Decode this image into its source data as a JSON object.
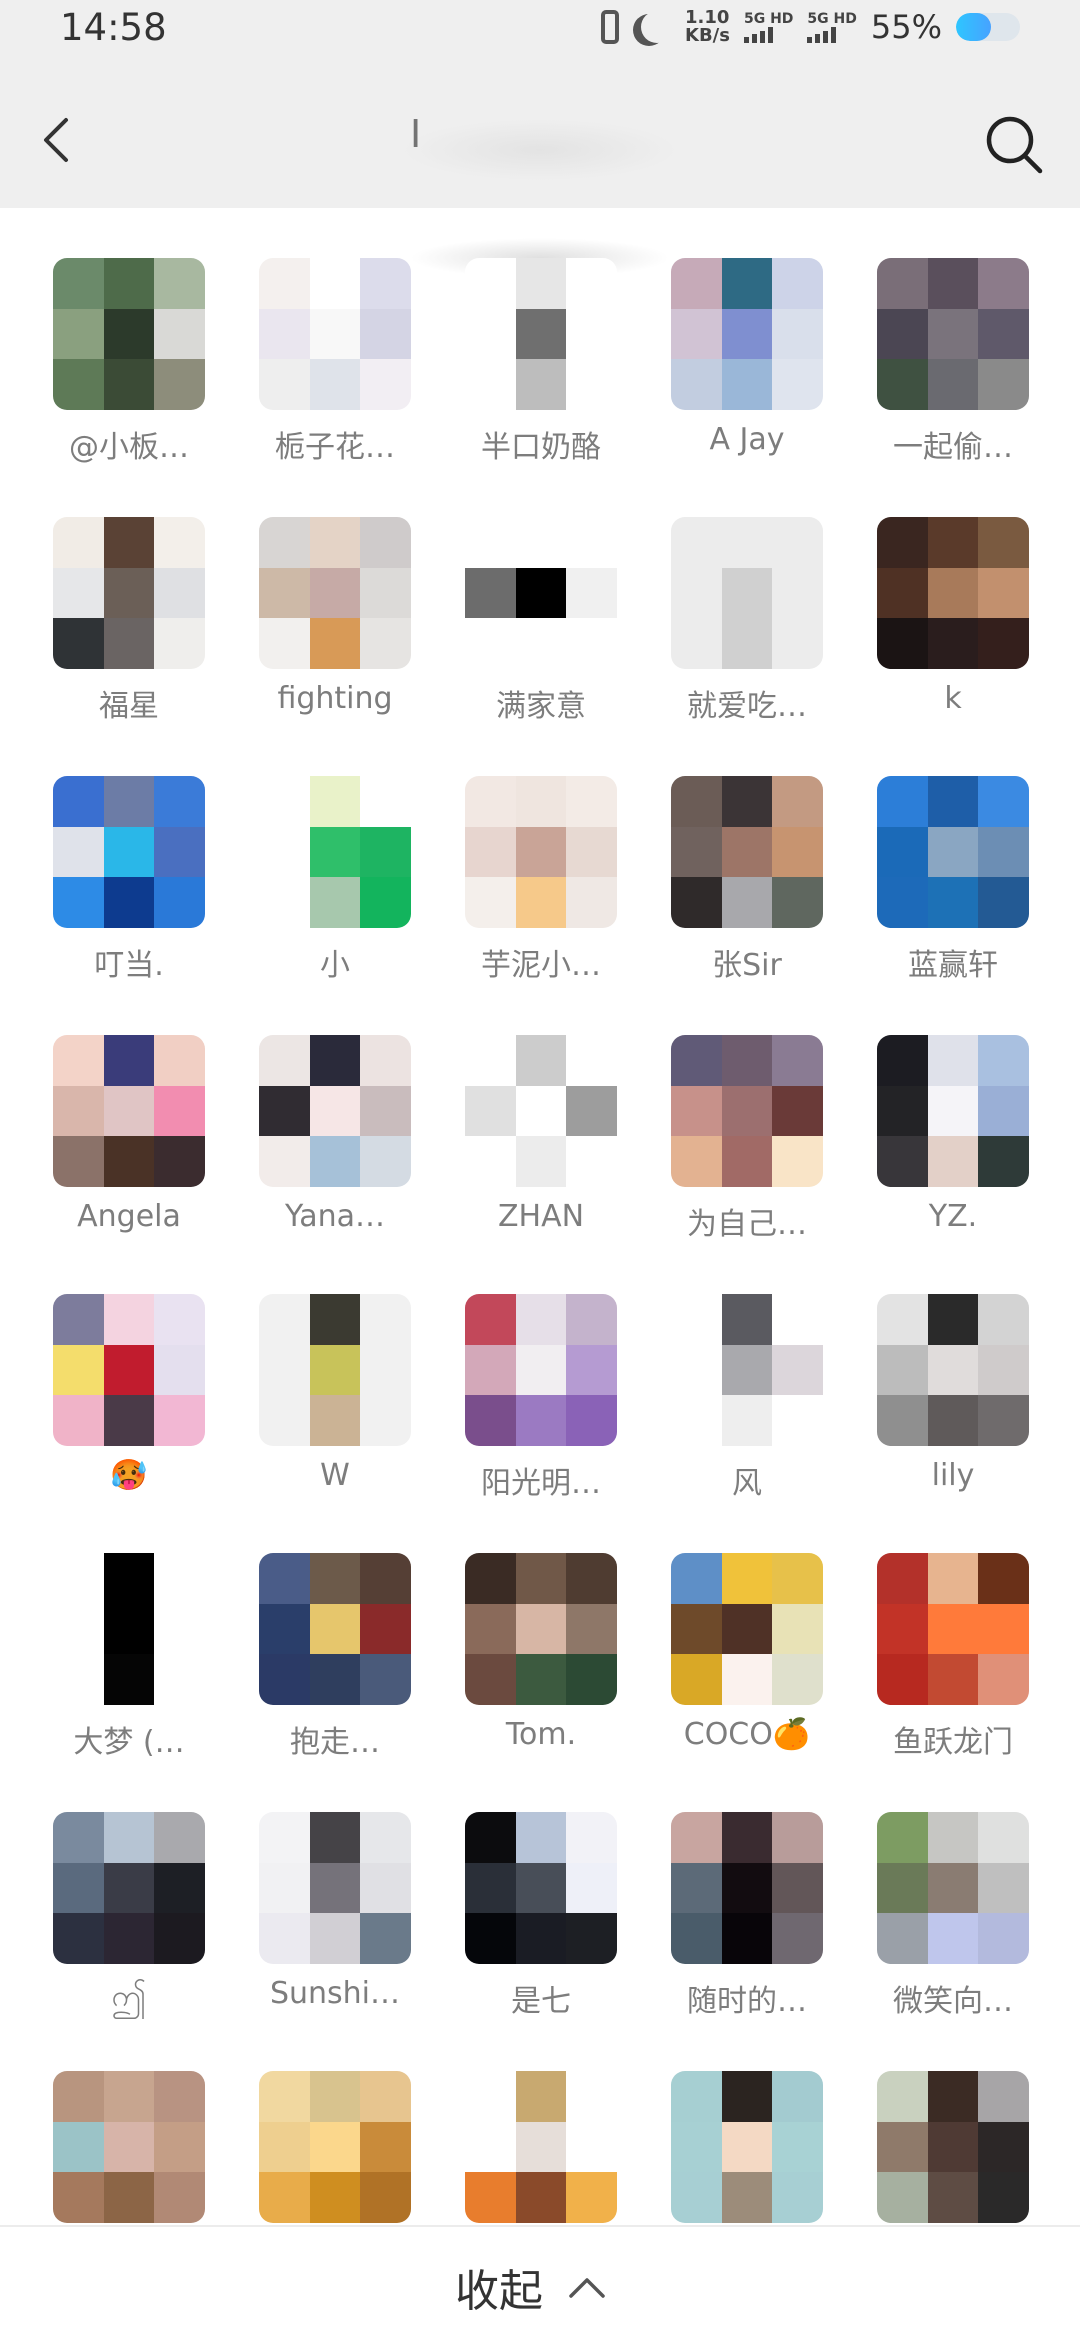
{
  "status": {
    "time": "14:58",
    "speed_value": "1.10",
    "speed_unit": "KB/s",
    "sim1": "5G HD",
    "sim2": "5G HD",
    "battery": "55%"
  },
  "header": {
    "back_icon": "back-arrow-icon",
    "title": "I",
    "search_icon": "search-icon"
  },
  "contacts": [
    {
      "name": "@小板…",
      "colors": [
        "#6b8a6a",
        "#4e6b4a",
        "#a8b8a0",
        "#8aa07f",
        "#2c3a2b",
        "#d9d9d6",
        "#5e7a57",
        "#3b4b36",
        "#8d8d7b"
      ]
    },
    {
      "name": "栀子花…",
      "colors": [
        "#f4f0ee",
        "#ffffff",
        "#dcdceb",
        "#eae6ef",
        "#f8f8f8",
        "#d4d4e4",
        "#eeeeee",
        "#dfe3ea",
        "#f2eef3"
      ]
    },
    {
      "name": "半口奶酪",
      "colors": [
        "#ffffff",
        "#e6e6e6",
        "#ffffff",
        "#ffffff",
        "#6f6f6f",
        "#ffffff",
        "#ffffff",
        "#bdbdbd",
        "#ffffff"
      ]
    },
    {
      "name": "A  Jay",
      "colors": [
        "#c6aab8",
        "#2e6a84",
        "#cdd3e8",
        "#d1c3d4",
        "#7f8fd0",
        "#d9dfeb",
        "#c2cde0",
        "#9ab7d8",
        "#dfe4ee"
      ]
    },
    {
      "name": "一起偷…",
      "colors": [
        "#7a6e78",
        "#5a4f5c",
        "#8c7b8a",
        "#4b4653",
        "#7a737c",
        "#5f596a",
        "#3f5141",
        "#6a6a70",
        "#8a8a8a"
      ]
    },
    {
      "name": "福星",
      "colors": [
        "#f1ece6",
        "#5a4235",
        "#f3efea",
        "#e6e7e9",
        "#6b5f57",
        "#dfe0e3",
        "#2f3336",
        "#6a6463",
        "#efeeec"
      ]
    },
    {
      "name": "fighting",
      "colors": [
        "#d8d5d3",
        "#e4d3c6",
        "#cfcbcb",
        "#cdb9a7",
        "#c6aaa6",
        "#dcdad8",
        "#f2f0ee",
        "#d89a57",
        "#e6e4e2"
      ]
    },
    {
      "name": "满家意",
      "colors": [
        "#ffffff",
        "#ffffff",
        "#ffffff",
        "#6c6c6c",
        "#000000",
        "#f0f0f0",
        "#ffffff",
        "#ffffff",
        "#ffffff"
      ]
    },
    {
      "name": "就爱吃…",
      "colors": [
        "#ececec",
        "#ececec",
        "#ececec",
        "#ececec",
        "#d0d0d0",
        "#ececec",
        "#ececec",
        "#d0d0d0",
        "#ececec"
      ]
    },
    {
      "name": "k",
      "colors": [
        "#3a2620",
        "#5a3a2a",
        "#7a5a40",
        "#4f3124",
        "#a87a5a",
        "#c2906e",
        "#1b1414",
        "#2a1d1d",
        "#341f1c"
      ]
    },
    {
      "name": "叮当.",
      "colors": [
        "#3a6fd0",
        "#6c7ca6",
        "#3b7bd8",
        "#dfe2ea",
        "#2ab7e8",
        "#4a6fc0",
        "#2d8be6",
        "#0d3b8f",
        "#2a79d8"
      ]
    },
    {
      "name": "小",
      "colors": [
        "#ffffff",
        "#e9f2c9",
        "#ffffff",
        "#ffffff",
        "#2fbf6a",
        "#1eb462",
        "#ffffff",
        "#a7c8ad",
        "#13b45d"
      ]
    },
    {
      "name": "芋泥小…",
      "colors": [
        "#f2e8e3",
        "#efe5df",
        "#f3ebe6",
        "#e7d5cf",
        "#c9a497",
        "#e7d9d2",
        "#f4efeb",
        "#f6c98a",
        "#efe8e4"
      ]
    },
    {
      "name": "张Sir",
      "colors": [
        "#6b5c56",
        "#3b3436",
        "#c39a82",
        "#70625e",
        "#9d7567",
        "#c79470",
        "#2f2a2a",
        "#a8a8ac",
        "#5f675f"
      ]
    },
    {
      "name": "蓝赢轩",
      "colors": [
        "#2c7ed8",
        "#1e5ea8",
        "#3b8ae2",
        "#1b6ab8",
        "#8aa6c2",
        "#6c8eb4",
        "#1d6ab9",
        "#1d71b6",
        "#235a94"
      ]
    },
    {
      "name": "Angela",
      "colors": [
        "#f3d3c8",
        "#3a3c7a",
        "#f1cfc4",
        "#d9b6ab",
        "#e0c5c5",
        "#f28db0",
        "#8b7269",
        "#4a3226",
        "#3b2c2f"
      ]
    },
    {
      "name": "Yana…",
      "colors": [
        "#ece6e4",
        "#2a2a3a",
        "#ece3e1",
        "#302c32",
        "#f6e6e6",
        "#c9bcbd",
        "#f2ecea",
        "#a6c1d8",
        "#d4dbe3"
      ]
    },
    {
      "name": "ZHAN",
      "colors": [
        "#ffffff",
        "#cccccc",
        "#ffffff",
        "#e0e0e0",
        "#ffffff",
        "#9d9d9d",
        "#ffffff",
        "#ececec",
        "#ffffff"
      ]
    },
    {
      "name": "为自己…",
      "colors": [
        "#605a77",
        "#6e5c6e",
        "#8a7b93",
        "#c7918a",
        "#9c6f6f",
        "#6a3a38",
        "#e3b291",
        "#a16a66",
        "#f9e4c7"
      ]
    },
    {
      "name": "YZ.",
      "colors": [
        "#1c1c22",
        "#dfe1ea",
        "#a9c0e0",
        "#232326",
        "#f5f4f8",
        "#9aafd6",
        "#38363a",
        "#e3d0c8",
        "#2e3a38"
      ]
    },
    {
      "name": "🥵",
      "colors": [
        "#7d7c9c",
        "#f4d3e0",
        "#e9e2f1",
        "#f4dd6c",
        "#c11c2e",
        "#e4dfee",
        "#f0b3c8",
        "#4a3a48",
        "#f2b7d3"
      ]
    },
    {
      "name": "W",
      "colors": [
        "#f1f1f1",
        "#3b3a31",
        "#f1f1f1",
        "#f1f1f1",
        "#c8c35a",
        "#f1f1f1",
        "#f1f1f1",
        "#cbb395",
        "#f1f1f1"
      ]
    },
    {
      "name": "阳光明…",
      "colors": [
        "#c2485a",
        "#e6dfe8",
        "#c4b3cc",
        "#d3a8b9",
        "#f1eef1",
        "#b59bd2",
        "#7a4e8c",
        "#9b7ac2",
        "#8a62b7"
      ]
    },
    {
      "name": "风",
      "colors": [
        "#ffffff",
        "#5a5a60",
        "#ffffff",
        "#ffffff",
        "#a9a9ad",
        "#dcd6db",
        "#ffffff",
        "#eeeeee",
        "#ffffff"
      ]
    },
    {
      "name": "lily",
      "colors": [
        "#e3e3e3",
        "#2a2a2a",
        "#d3d3d3",
        "#bcbcbc",
        "#e0dcdb",
        "#cfcbcb",
        "#8f8f8f",
        "#5f5a5a",
        "#6f6b6c"
      ]
    },
    {
      "name": "大梦 (…",
      "colors": [
        "#ffffff",
        "#000000",
        "#ffffff",
        "#ffffff",
        "#000000",
        "#ffffff",
        "#ffffff",
        "#050505",
        "#ffffff"
      ]
    },
    {
      "name": "抱走…",
      "colors": [
        "#4a5c88",
        "#6c5a4a",
        "#553f35",
        "#2a3e6a",
        "#e6c66c",
        "#8a2a2a",
        "#2b3a66",
        "#2f3e5e",
        "#4a5a7a"
      ]
    },
    {
      "name": "Tom.",
      "colors": [
        "#3a2b24",
        "#705848",
        "#4f3c31",
        "#8a6a5a",
        "#d7b6a5",
        "#8e7768",
        "#6b4a3f",
        "#3c5a3f",
        "#2c4a34"
      ]
    },
    {
      "name": "COCO🍊",
      "colors": [
        "#5e8fc7",
        "#f0c23a",
        "#e7c14a",
        "#6e4a2a",
        "#4f3126",
        "#e8e2b6",
        "#d9a826",
        "#fbf2ee",
        "#dfe0cc"
      ]
    },
    {
      "name": "鱼跃龙门",
      "colors": [
        "#b3312a",
        "#e7b48f",
        "#6a3018",
        "#c23327",
        "#ff7a3a",
        "#ff7a3a",
        "#b72920",
        "#c24a32",
        "#e09078"
      ]
    },
    {
      "name": "ဤ",
      "colors": [
        "#7a8a9e",
        "#b6c4d3",
        "#a9a9ad",
        "#5a6a7e",
        "#3a3c47",
        "#1d1f25",
        "#2c3040",
        "#2c2633",
        "#1c1a20"
      ]
    },
    {
      "name": "Sunshi…",
      "colors": [
        "#f3f3f5",
        "#454347",
        "#e6e7ea",
        "#f1f1f3",
        "#75727a",
        "#e0e0e4",
        "#ebeaf0",
        "#d1cfd4",
        "#6a7a8a"
      ]
    },
    {
      "name": "是七",
      "colors": [
        "#0c0c0e",
        "#b7c4d8",
        "#f2f2f7",
        "#2a2f38",
        "#484e58",
        "#eef0f8",
        "#05060a",
        "#1a1c24",
        "#1d1f24"
      ]
    },
    {
      "name": "随时的…",
      "colors": [
        "#c8a5a0",
        "#3a2b30",
        "#b89c9a",
        "#5c6a78",
        "#120c10",
        "#625658",
        "#4a5c6a",
        "#080509",
        "#6f6870"
      ]
    },
    {
      "name": "微笑向…",
      "colors": [
        "#7d9c62",
        "#c6c6c3",
        "#dfe0df",
        "#6a7a58",
        "#8a7c72",
        "#bfbfbf",
        "#9aa0a8",
        "#bfc6ec",
        "#b3badd"
      ]
    },
    {
      "name": "",
      "colors": [
        "#b8957f",
        "#c7a58f",
        "#b89382",
        "#9bc3c7",
        "#d7b4a9",
        "#c49e86",
        "#a5795d",
        "#8c6546",
        "#b18975"
      ]
    },
    {
      "name": "",
      "colors": [
        "#f1d8a0",
        "#d8c38e",
        "#e7c58f",
        "#eecf8f",
        "#fbd78c",
        "#c98b3a",
        "#e8ac4a",
        "#cf8e20",
        "#b07226"
      ]
    },
    {
      "name": "",
      "colors": [
        "#ffffff",
        "#c8a970",
        "#ffffff",
        "#ffffff",
        "#e6ded9",
        "#ffffff",
        "#e87d2d",
        "#8a4a2a",
        "#f1b14a"
      ]
    },
    {
      "name": "",
      "colors": [
        "#a6cfd2",
        "#2b2420",
        "#a3cbd0",
        "#a7d0d3",
        "#f4d9c4",
        "#a8d2d4",
        "#a7cfd3",
        "#9c8c7a",
        "#a7cfd3"
      ]
    },
    {
      "name": "",
      "colors": [
        "#c9d1bf",
        "#3b2b24",
        "#a7a5a7",
        "#8f7a6a",
        "#4f3a34",
        "#2c2727",
        "#a6b0a0",
        "#5e4c44",
        "#2a2929"
      ]
    }
  ],
  "bottom": {
    "collapse_label": "收起",
    "collapse_icon": "chevron-up-icon"
  }
}
